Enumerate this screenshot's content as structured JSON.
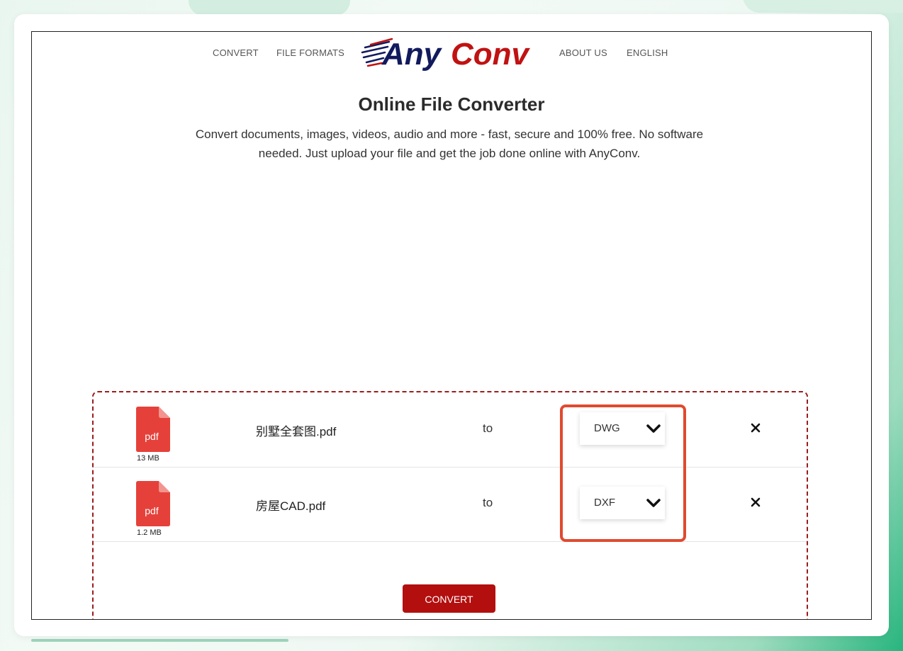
{
  "nav": {
    "convert": "CONVERT",
    "file_formats": "FILE FORMATS",
    "about_us": "ABOUT US",
    "language": "ENGLISH"
  },
  "logo": {
    "text_any": "Any",
    "text_conv": "Conv",
    "colors": {
      "navy": "#121a5e",
      "red": "#c01212"
    }
  },
  "hero": {
    "title": "Online File Converter",
    "subtitle_line1": "Convert documents, images, videos, audio and more - fast, secure and 100% free. No software",
    "subtitle_line2": "needed. Just upload your file and get the job done online with AnyConv."
  },
  "files": [
    {
      "icon_label": "pdf",
      "size": "13 MB",
      "name": "别墅全套图.pdf",
      "to": "to",
      "target_format": "DWG"
    },
    {
      "icon_label": "pdf",
      "size": "1.2 MB",
      "name": "房屋CAD.pdf",
      "to": "to",
      "target_format": "DXF"
    }
  ],
  "icons": {
    "file": "pdf-file-icon",
    "dropdown": "chevron-down-icon",
    "remove": "close-icon"
  },
  "colors": {
    "accent": "#b30f0f",
    "highlight": "#e04a2e",
    "pdf_red": "#e5413a"
  },
  "actions": {
    "convert_label": "CONVERT"
  }
}
